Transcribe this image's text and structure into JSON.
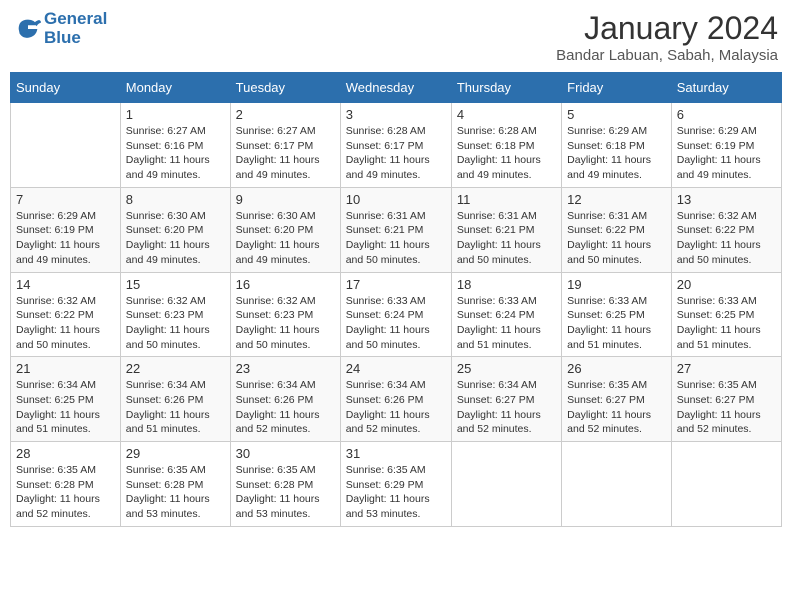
{
  "logo": {
    "line1": "General",
    "line2": "Blue"
  },
  "title": "January 2024",
  "location": "Bandar Labuan, Sabah, Malaysia",
  "days_of_week": [
    "Sunday",
    "Monday",
    "Tuesday",
    "Wednesday",
    "Thursday",
    "Friday",
    "Saturday"
  ],
  "weeks": [
    [
      {
        "num": "",
        "sunrise": "",
        "sunset": "",
        "daylight": ""
      },
      {
        "num": "1",
        "sunrise": "Sunrise: 6:27 AM",
        "sunset": "Sunset: 6:16 PM",
        "daylight": "Daylight: 11 hours and 49 minutes."
      },
      {
        "num": "2",
        "sunrise": "Sunrise: 6:27 AM",
        "sunset": "Sunset: 6:17 PM",
        "daylight": "Daylight: 11 hours and 49 minutes."
      },
      {
        "num": "3",
        "sunrise": "Sunrise: 6:28 AM",
        "sunset": "Sunset: 6:17 PM",
        "daylight": "Daylight: 11 hours and 49 minutes."
      },
      {
        "num": "4",
        "sunrise": "Sunrise: 6:28 AM",
        "sunset": "Sunset: 6:18 PM",
        "daylight": "Daylight: 11 hours and 49 minutes."
      },
      {
        "num": "5",
        "sunrise": "Sunrise: 6:29 AM",
        "sunset": "Sunset: 6:18 PM",
        "daylight": "Daylight: 11 hours and 49 minutes."
      },
      {
        "num": "6",
        "sunrise": "Sunrise: 6:29 AM",
        "sunset": "Sunset: 6:19 PM",
        "daylight": "Daylight: 11 hours and 49 minutes."
      }
    ],
    [
      {
        "num": "7",
        "sunrise": "Sunrise: 6:29 AM",
        "sunset": "Sunset: 6:19 PM",
        "daylight": "Daylight: 11 hours and 49 minutes."
      },
      {
        "num": "8",
        "sunrise": "Sunrise: 6:30 AM",
        "sunset": "Sunset: 6:20 PM",
        "daylight": "Daylight: 11 hours and 49 minutes."
      },
      {
        "num": "9",
        "sunrise": "Sunrise: 6:30 AM",
        "sunset": "Sunset: 6:20 PM",
        "daylight": "Daylight: 11 hours and 49 minutes."
      },
      {
        "num": "10",
        "sunrise": "Sunrise: 6:31 AM",
        "sunset": "Sunset: 6:21 PM",
        "daylight": "Daylight: 11 hours and 50 minutes."
      },
      {
        "num": "11",
        "sunrise": "Sunrise: 6:31 AM",
        "sunset": "Sunset: 6:21 PM",
        "daylight": "Daylight: 11 hours and 50 minutes."
      },
      {
        "num": "12",
        "sunrise": "Sunrise: 6:31 AM",
        "sunset": "Sunset: 6:22 PM",
        "daylight": "Daylight: 11 hours and 50 minutes."
      },
      {
        "num": "13",
        "sunrise": "Sunrise: 6:32 AM",
        "sunset": "Sunset: 6:22 PM",
        "daylight": "Daylight: 11 hours and 50 minutes."
      }
    ],
    [
      {
        "num": "14",
        "sunrise": "Sunrise: 6:32 AM",
        "sunset": "Sunset: 6:22 PM",
        "daylight": "Daylight: 11 hours and 50 minutes."
      },
      {
        "num": "15",
        "sunrise": "Sunrise: 6:32 AM",
        "sunset": "Sunset: 6:23 PM",
        "daylight": "Daylight: 11 hours and 50 minutes."
      },
      {
        "num": "16",
        "sunrise": "Sunrise: 6:32 AM",
        "sunset": "Sunset: 6:23 PM",
        "daylight": "Daylight: 11 hours and 50 minutes."
      },
      {
        "num": "17",
        "sunrise": "Sunrise: 6:33 AM",
        "sunset": "Sunset: 6:24 PM",
        "daylight": "Daylight: 11 hours and 50 minutes."
      },
      {
        "num": "18",
        "sunrise": "Sunrise: 6:33 AM",
        "sunset": "Sunset: 6:24 PM",
        "daylight": "Daylight: 11 hours and 51 minutes."
      },
      {
        "num": "19",
        "sunrise": "Sunrise: 6:33 AM",
        "sunset": "Sunset: 6:25 PM",
        "daylight": "Daylight: 11 hours and 51 minutes."
      },
      {
        "num": "20",
        "sunrise": "Sunrise: 6:33 AM",
        "sunset": "Sunset: 6:25 PM",
        "daylight": "Daylight: 11 hours and 51 minutes."
      }
    ],
    [
      {
        "num": "21",
        "sunrise": "Sunrise: 6:34 AM",
        "sunset": "Sunset: 6:25 PM",
        "daylight": "Daylight: 11 hours and 51 minutes."
      },
      {
        "num": "22",
        "sunrise": "Sunrise: 6:34 AM",
        "sunset": "Sunset: 6:26 PM",
        "daylight": "Daylight: 11 hours and 51 minutes."
      },
      {
        "num": "23",
        "sunrise": "Sunrise: 6:34 AM",
        "sunset": "Sunset: 6:26 PM",
        "daylight": "Daylight: 11 hours and 52 minutes."
      },
      {
        "num": "24",
        "sunrise": "Sunrise: 6:34 AM",
        "sunset": "Sunset: 6:26 PM",
        "daylight": "Daylight: 11 hours and 52 minutes."
      },
      {
        "num": "25",
        "sunrise": "Sunrise: 6:34 AM",
        "sunset": "Sunset: 6:27 PM",
        "daylight": "Daylight: 11 hours and 52 minutes."
      },
      {
        "num": "26",
        "sunrise": "Sunrise: 6:35 AM",
        "sunset": "Sunset: 6:27 PM",
        "daylight": "Daylight: 11 hours and 52 minutes."
      },
      {
        "num": "27",
        "sunrise": "Sunrise: 6:35 AM",
        "sunset": "Sunset: 6:27 PM",
        "daylight": "Daylight: 11 hours and 52 minutes."
      }
    ],
    [
      {
        "num": "28",
        "sunrise": "Sunrise: 6:35 AM",
        "sunset": "Sunset: 6:28 PM",
        "daylight": "Daylight: 11 hours and 52 minutes."
      },
      {
        "num": "29",
        "sunrise": "Sunrise: 6:35 AM",
        "sunset": "Sunset: 6:28 PM",
        "daylight": "Daylight: 11 hours and 53 minutes."
      },
      {
        "num": "30",
        "sunrise": "Sunrise: 6:35 AM",
        "sunset": "Sunset: 6:28 PM",
        "daylight": "Daylight: 11 hours and 53 minutes."
      },
      {
        "num": "31",
        "sunrise": "Sunrise: 6:35 AM",
        "sunset": "Sunset: 6:29 PM",
        "daylight": "Daylight: 11 hours and 53 minutes."
      },
      {
        "num": "",
        "sunrise": "",
        "sunset": "",
        "daylight": ""
      },
      {
        "num": "",
        "sunrise": "",
        "sunset": "",
        "daylight": ""
      },
      {
        "num": "",
        "sunrise": "",
        "sunset": "",
        "daylight": ""
      }
    ]
  ]
}
